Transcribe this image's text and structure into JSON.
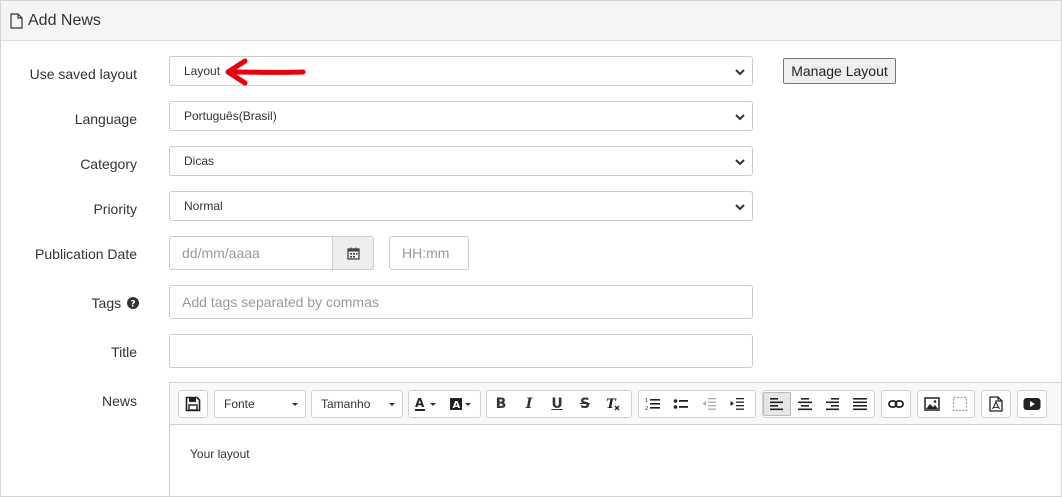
{
  "panel": {
    "title": "Add News"
  },
  "form": {
    "saved_layout": {
      "label": "Use saved layout",
      "value": "Layout",
      "button": "Manage Layout"
    },
    "language": {
      "label": "Language",
      "value": "Português(Brasil)"
    },
    "category": {
      "label": "Category",
      "value": "Dicas"
    },
    "priority": {
      "label": "Priority",
      "value": "Normal"
    },
    "publication_date": {
      "label": "Publication Date",
      "date_placeholder": "dd/mm/aaaa",
      "time_placeholder": "HH:mm"
    },
    "tags": {
      "label": "Tags",
      "placeholder": "Add tags separated by commas"
    },
    "title": {
      "label": "Title",
      "value": ""
    },
    "news": {
      "label": "News"
    }
  },
  "editor": {
    "font_combo": "Fonte",
    "size_combo": "Tamanho",
    "content": "Your layout"
  },
  "annotation": {
    "arrow_color": "#e8000b"
  }
}
